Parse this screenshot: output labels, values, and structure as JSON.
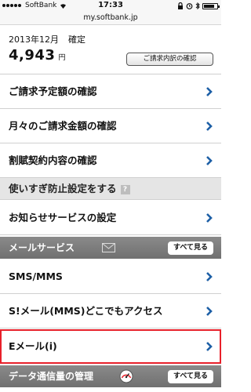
{
  "status_bar": {
    "carrier": "SoftBank",
    "time": "17:33",
    "url": "my.softbank.jp"
  },
  "billing": {
    "month": "2013年12月",
    "status": "確定",
    "amount": "4,943",
    "unit": "円",
    "detail_button": "ご請求内訳の確認"
  },
  "menu": {
    "estimate": "ご請求予定額の確認",
    "monthly": "月々のご請求金額の確認",
    "installment": "割賦契約内容の確認",
    "overuse": "使いすぎ防止設定をする",
    "overuse_help": "?",
    "notify": "お知らせサービスの設定"
  },
  "mail_section": {
    "title": "メールサービス",
    "see_all": "すべて見る",
    "items": [
      "SMS/MMS",
      "S!メール(MMS)どこでもアクセス",
      "Eメール(i)"
    ]
  },
  "data_section": {
    "title": "データ通信量の管理",
    "see_all": "すべて見る"
  },
  "colors": {
    "accent_blue": "#1d5fa6",
    "highlight_red": "#e8202a",
    "section_gray": "#7d7d7d"
  }
}
